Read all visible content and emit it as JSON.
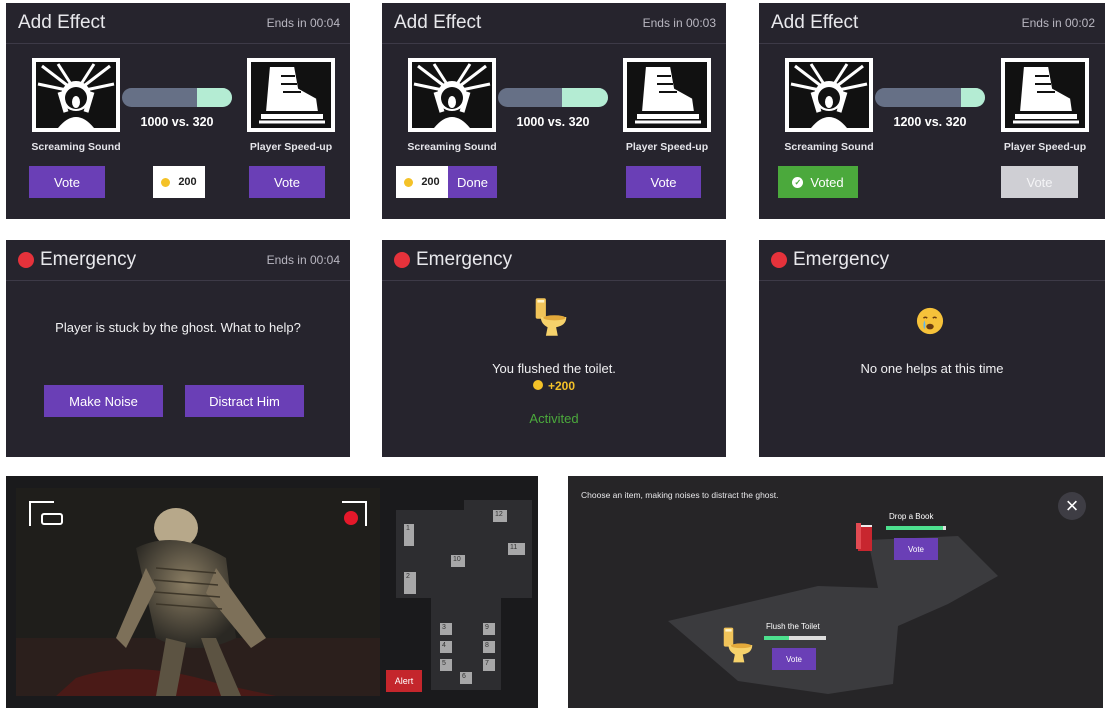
{
  "vote_panels": [
    {
      "title": "Add Effect",
      "timer": "Ends in 00:04",
      "left_label": "Screaming Sound",
      "right_label": "Player Speed-up",
      "score": "1000 vs. 320",
      "bar_fraction": 0.32,
      "coin": "200",
      "vote_left": "Vote",
      "vote_right": "Vote"
    },
    {
      "title": "Add Effect",
      "timer": "Ends in 00:03",
      "left_label": "Screaming Sound",
      "right_label": "Player Speed-up",
      "score": "1000 vs. 320",
      "bar_fraction": 0.42,
      "coin": "200",
      "done": "Done",
      "vote_right": "Vote"
    },
    {
      "title": "Add Effect",
      "timer": "Ends in 00:02",
      "left_label": "Screaming Sound",
      "right_label": "Player Speed-up",
      "score": "1200 vs. 320",
      "bar_fraction": 0.22,
      "voted": "Voted",
      "vote_right": "Vote"
    }
  ],
  "emergency_panels": [
    {
      "title": "Emergency",
      "timer": "Ends in 00:04",
      "question": "Player is stuck by the ghost. What to help?",
      "btn1": "Make Noise",
      "btn2": "Distract Him"
    },
    {
      "title": "Emergency",
      "message": "You flushed the toilet.",
      "reward": "+200",
      "status": "Activited"
    },
    {
      "title": "Emergency",
      "message": "No one helps at this time"
    }
  ],
  "camera": {
    "alert": "Alert",
    "rooms": [
      "1",
      "2",
      "3",
      "4",
      "5",
      "6",
      "7",
      "8",
      "9",
      "10",
      "11",
      "12"
    ]
  },
  "overlay": {
    "instruction": "Choose an item, making noises to distract the ghost.",
    "close": "×",
    "item1": {
      "label": "Drop a Book",
      "vote": "Vote",
      "progress": 0.95
    },
    "item2": {
      "label": "Flush the Toilet",
      "vote": "Vote",
      "progress": 0.4
    }
  },
  "colors": {
    "panel": "#26242d",
    "purple": "#6a3fb6",
    "green": "#4ba93c",
    "red": "#e5323b",
    "bar_track": "#667086",
    "bar_fill": "#b4ecd3",
    "coin": "#f4c228"
  }
}
